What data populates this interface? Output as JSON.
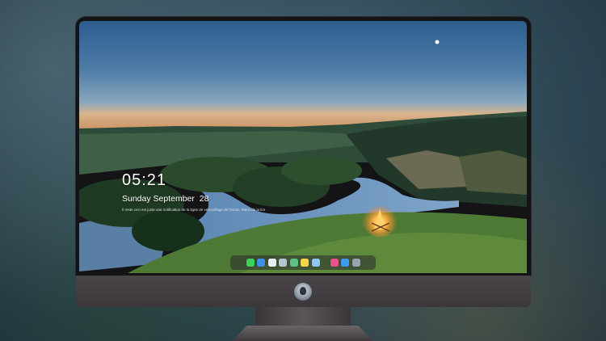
{
  "lock_screen": {
    "time": "05:21",
    "date": "Sunday September  28",
    "note": "Il reste ceci est juste une notification de la ligne de verrouillage  de l'écran.  Merci de la lire"
  },
  "dock": {
    "icons": [
      {
        "name": "messages-icon",
        "color": "#3ecf5c"
      },
      {
        "name": "finder-icon",
        "color": "#3f8ee8"
      },
      {
        "name": "safari-icon",
        "color": "#e9eef3"
      },
      {
        "name": "preview-icon",
        "color": "#b7c6d6"
      },
      {
        "name": "maps-icon",
        "color": "#5fbf8a"
      },
      {
        "name": "notes-icon",
        "color": "#f6d54a"
      },
      {
        "name": "photos-icon",
        "color": "#8fc7f0"
      },
      {
        "name": "itunes-icon",
        "color": "#e6548d"
      },
      {
        "name": "app-store-icon",
        "color": "#3d9bf0"
      },
      {
        "name": "camera-icon",
        "color": "#9aa2ab"
      }
    ]
  }
}
